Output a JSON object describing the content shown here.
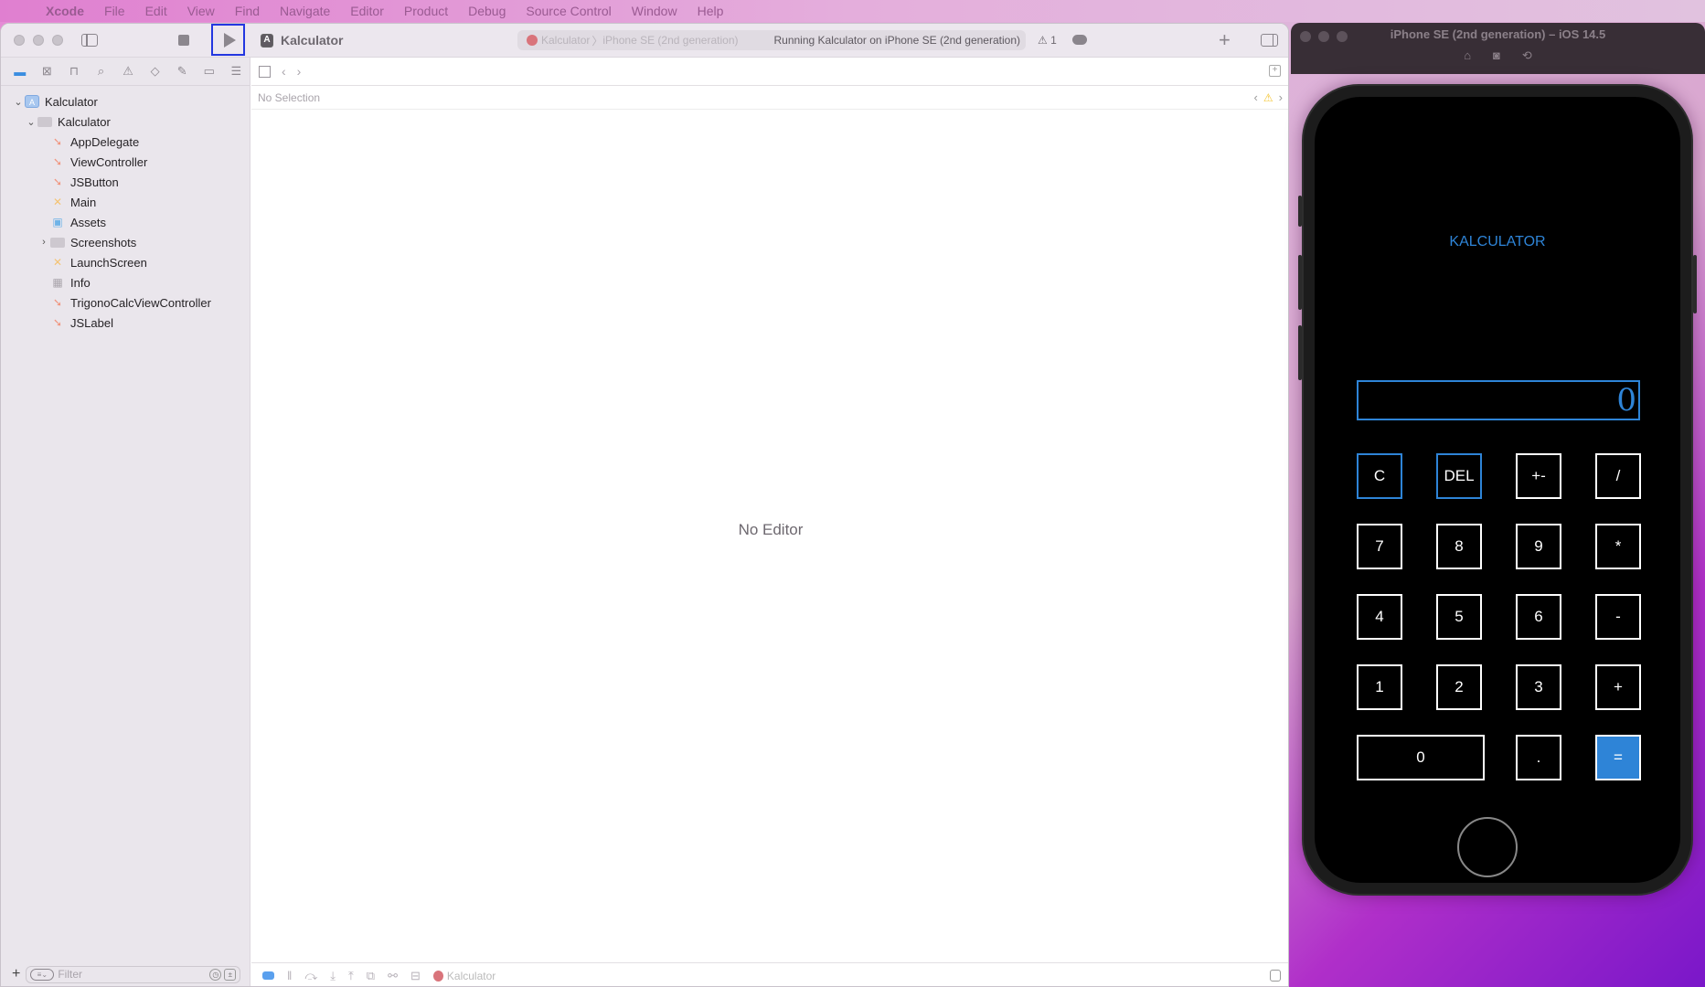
{
  "menubar": {
    "app": "Xcode",
    "items": [
      "File",
      "Edit",
      "View",
      "Find",
      "Navigate",
      "Editor",
      "Product",
      "Debug",
      "Source Control",
      "Window",
      "Help"
    ]
  },
  "toolbar": {
    "project_title": "Kalculator",
    "scheme_target": "Kalculator",
    "scheme_device": "iPhone SE (2nd generation)",
    "status": "Running Kalculator on iPhone SE (2nd generation)",
    "warning_count": "1",
    "run_label": "▶",
    "add_label": "+"
  },
  "navigator": {
    "tabs": [
      "folder-icon",
      "source-control-icon",
      "symbol-icon",
      "find-icon",
      "issue-icon",
      "test-icon",
      "debug-icon",
      "breakpoint-icon",
      "report-icon"
    ],
    "tree": [
      {
        "name": "Kalculator",
        "type": "project",
        "level": 0,
        "expanded": true
      },
      {
        "name": "Kalculator",
        "type": "folder",
        "level": 1,
        "expanded": true
      },
      {
        "name": "AppDelegate",
        "type": "swift",
        "level": 2
      },
      {
        "name": "ViewController",
        "type": "swift",
        "level": 2
      },
      {
        "name": "JSButton",
        "type": "swift",
        "level": 2
      },
      {
        "name": "Main",
        "type": "storyboard",
        "level": 2
      },
      {
        "name": "Assets",
        "type": "assets",
        "level": 2
      },
      {
        "name": "Screenshots",
        "type": "folder",
        "level": 2,
        "expanded": false
      },
      {
        "name": "LaunchScreen",
        "type": "storyboard",
        "level": 2
      },
      {
        "name": "Info",
        "type": "plist",
        "level": 2
      },
      {
        "name": "TrigonoCalcViewController",
        "type": "swift",
        "level": 2
      },
      {
        "name": "JSLabel",
        "type": "swift",
        "level": 2
      }
    ],
    "filter_placeholder": "Filter"
  },
  "editor": {
    "selection": "No Selection",
    "empty_message": "No Editor"
  },
  "debugbar": {
    "target": "Kalculator"
  },
  "simulator": {
    "title": "iPhone SE (2nd generation) – iOS 14.5",
    "app": {
      "title": "KALCULATOR",
      "display": "0",
      "keys": [
        {
          "label": "C",
          "style": "blue"
        },
        {
          "label": "DEL",
          "style": "blue"
        },
        {
          "label": "+-",
          "style": "normal"
        },
        {
          "label": "/",
          "style": "normal"
        },
        {
          "label": "7",
          "style": "normal"
        },
        {
          "label": "8",
          "style": "normal"
        },
        {
          "label": "9",
          "style": "normal"
        },
        {
          "label": "*",
          "style": "normal"
        },
        {
          "label": "4",
          "style": "normal"
        },
        {
          "label": "5",
          "style": "normal"
        },
        {
          "label": "6",
          "style": "normal"
        },
        {
          "label": "-",
          "style": "normal"
        },
        {
          "label": "1",
          "style": "normal"
        },
        {
          "label": "2",
          "style": "normal"
        },
        {
          "label": "3",
          "style": "normal"
        },
        {
          "label": "+",
          "style": "normal"
        },
        {
          "label": "0",
          "style": "wide"
        },
        {
          "label": ".",
          "style": "normal"
        },
        {
          "label": "=",
          "style": "equals"
        }
      ]
    }
  },
  "colors": {
    "accent": "#2e84d7",
    "run_highlight": "#2337e0"
  }
}
